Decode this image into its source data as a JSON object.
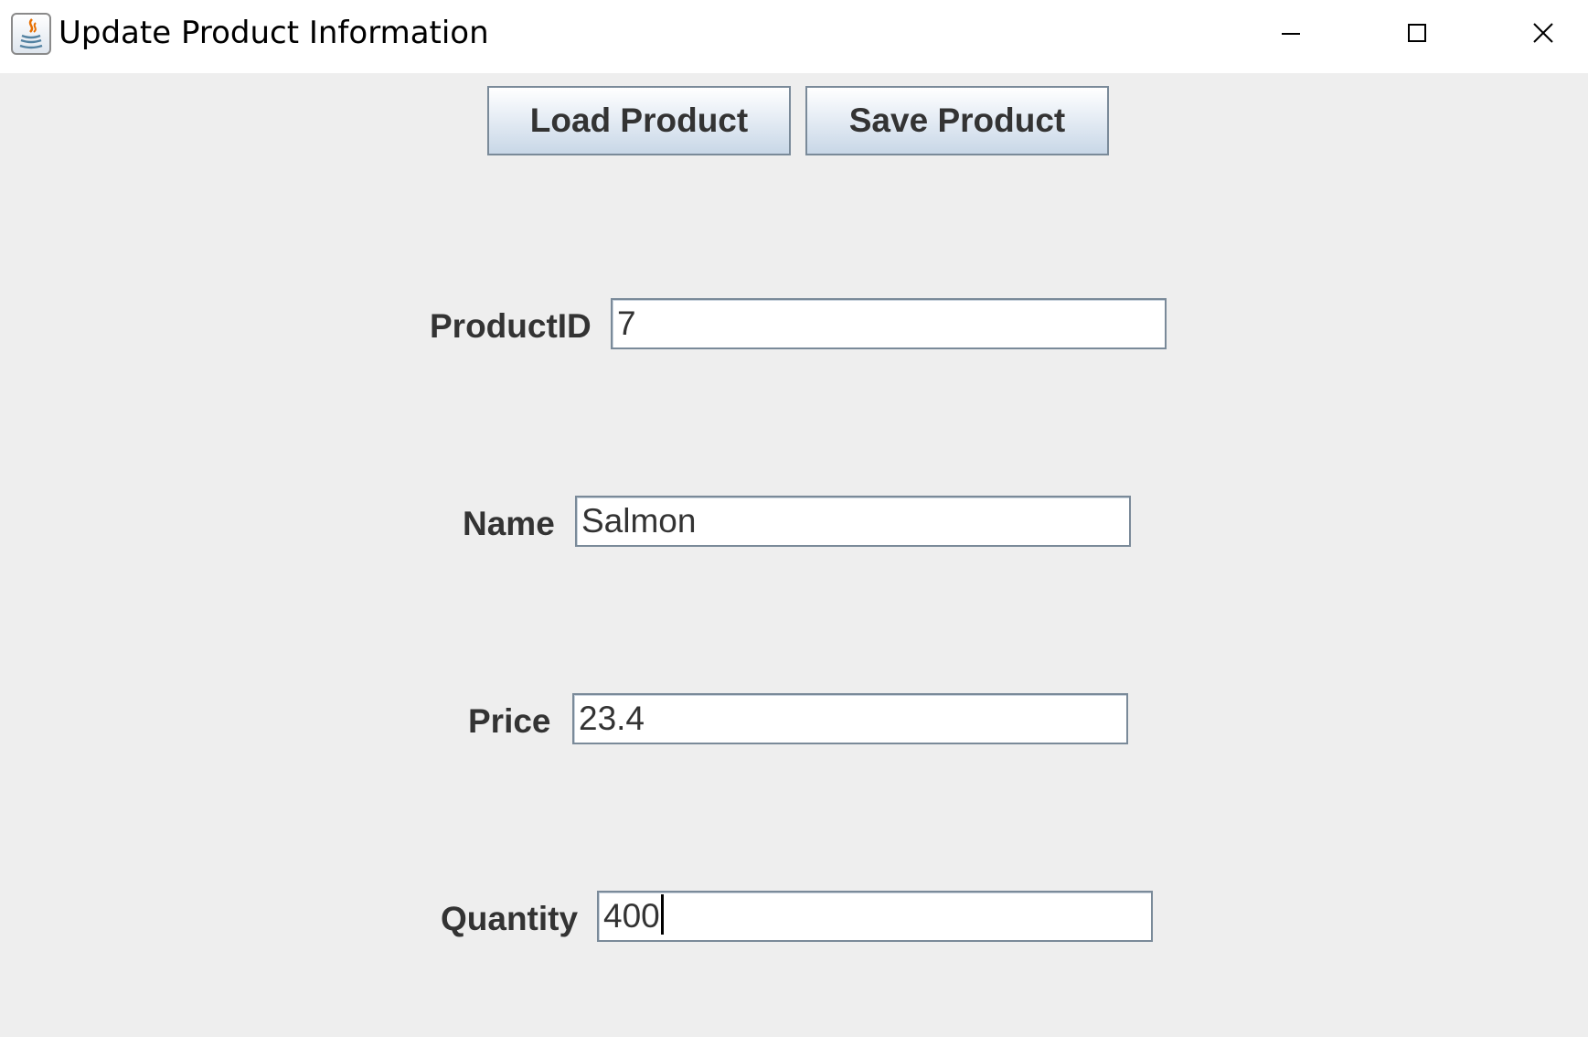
{
  "window": {
    "title": "Update Product Information",
    "app_icon": "java-coffee-cup-icon"
  },
  "controls": {
    "minimize_icon": "minimize-icon",
    "maximize_icon": "maximize-icon",
    "close_icon": "close-icon"
  },
  "toolbar": {
    "load_label": "Load Product",
    "save_label": "Save Product"
  },
  "form": {
    "product_id": {
      "label": "ProductID",
      "value": "7"
    },
    "name": {
      "label": "Name",
      "value": "Salmon"
    },
    "price": {
      "label": "Price",
      "value": "23.4"
    },
    "quantity": {
      "label": "Quantity",
      "value": "400"
    }
  },
  "colors": {
    "background": "#eeeeee",
    "button_border": "#7a8a99",
    "label_text": "#333333"
  }
}
